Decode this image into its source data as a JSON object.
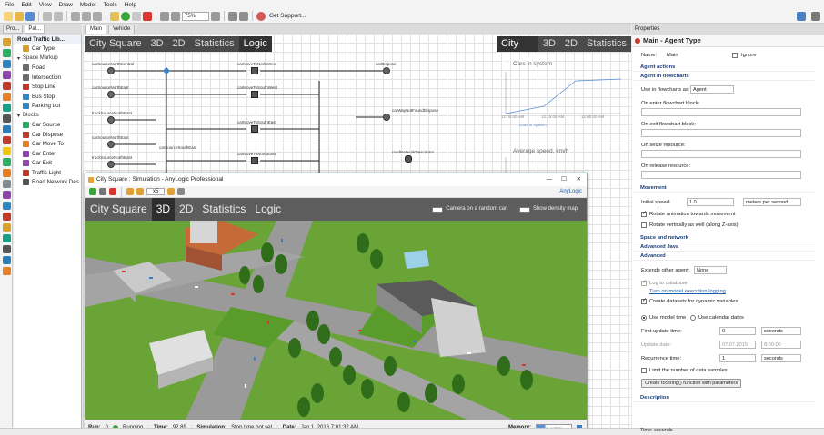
{
  "menu": [
    "File",
    "Edit",
    "View",
    "Draw",
    "Model",
    "Tools",
    "Help"
  ],
  "toolbar": {
    "zoom": "75%",
    "support_label": "Get Support..."
  },
  "palette": {
    "tabs": [
      "Pro...",
      "Pal..."
    ],
    "title": "Road Traffic Lib...",
    "items": [
      {
        "label": "Car Type",
        "kind": "item",
        "icon": "car-type-icon",
        "color": "#d9a12b"
      },
      {
        "label": "Space Markup",
        "kind": "section"
      },
      {
        "label": "Road",
        "kind": "item",
        "icon": "road-icon",
        "color": "#6b6b6b"
      },
      {
        "label": "Intersection",
        "kind": "item",
        "icon": "intersection-icon",
        "color": "#6b6b6b"
      },
      {
        "label": "Stop Line",
        "kind": "item",
        "icon": "stop-line-icon",
        "color": "#c0392b"
      },
      {
        "label": "Bus Stop",
        "kind": "item",
        "icon": "bus-stop-icon",
        "color": "#2e86c1"
      },
      {
        "label": "Parking Lot",
        "kind": "item",
        "icon": "parking-lot-icon",
        "color": "#2e86c1"
      },
      {
        "label": "Blocks",
        "kind": "section"
      },
      {
        "label": "Car Source",
        "kind": "item",
        "icon": "car-source-icon",
        "color": "#27ae60"
      },
      {
        "label": "Car Dispose",
        "kind": "item",
        "icon": "car-dispose-icon",
        "color": "#c0392b"
      },
      {
        "label": "Car Move To",
        "kind": "item",
        "icon": "car-move-to-icon",
        "color": "#e67e22"
      },
      {
        "label": "Car Enter",
        "kind": "item",
        "icon": "car-enter-icon",
        "color": "#8e44ad"
      },
      {
        "label": "Car Exit",
        "kind": "item",
        "icon": "car-exit-icon",
        "color": "#8e44ad"
      },
      {
        "label": "Traffic Light",
        "kind": "item",
        "icon": "traffic-light-icon",
        "color": "#c0392b"
      },
      {
        "label": "Road Network Des...",
        "kind": "item",
        "icon": "road-network-icon",
        "color": "#555"
      }
    ]
  },
  "editor": {
    "tabs": [
      "Main",
      "Vehicle"
    ],
    "nav": [
      "City Square",
      "3D",
      "2D",
      "Statistics",
      "Logic"
    ],
    "nav_selected": "Logic",
    "nav2": [
      "City Square",
      "3D",
      "2D",
      "Statistics"
    ],
    "flow_nodes": [
      "carSourceNorthCentral",
      "carSourceNorthEast",
      "truckSourceNorthEast",
      "carSourceNorthEast",
      "truckSourceNorthEast",
      "carSourceNorthWest",
      "carSourceSouthEast",
      "carMoveToNorthWest",
      "carMoveToSouthWest",
      "carMoveToSouthEast",
      "carMoveToNorthEast",
      "carMoveToNorthWest",
      "carDispose",
      "carWayNotFoundDispose",
      "roadNetworkDescriptor"
    ],
    "chart1": {
      "title": "Cars in system",
      "ticks": [
        "12:00:00 AM",
        "12:15:00 AM",
        "12:00:00 AM"
      ],
      "legend": "Cars in system"
    },
    "chart2": {
      "title": "Average speed, km/h"
    }
  },
  "sim": {
    "title": "City Square : Simulation - AnyLogic Professional",
    "speed": "x5",
    "brand": "AnyLogic",
    "nav": [
      "City Square",
      "3D",
      "2D",
      "Statistics",
      "Logic"
    ],
    "nav_selected": "3D",
    "camera_label": "Camera on a random car",
    "density_label": "Show density map",
    "status": {
      "run_label": "Run:",
      "run_value": "0",
      "state": "Running",
      "time_label": "Time:",
      "time_value": "92.89",
      "simtime_label": "Simulation:",
      "simtime_value": "Stop time not set",
      "date_label": "Date:",
      "date_value": "Jan 1, 2016 7:01:32 AM",
      "memory_label": "Memory:",
      "memory_value": "0 of 455M"
    }
  },
  "props": {
    "tab": "Properties",
    "header": "Main - Agent Type",
    "name_label": "Name:",
    "name_value": "Main",
    "ignore_label": "Ignore",
    "sec_agent_actions": "Agent actions",
    "sec_agent_in_flowcharts": "Agent in flowcharts",
    "use_in_flowcharts_label": "Use in flowcharts as:",
    "use_in_flowcharts_value": "Agent",
    "on_enter_label": "On enter flowchart block:",
    "on_exit_label": "On exit flowchart block:",
    "on_seize_label": "On seize resource:",
    "on_release_label": "On release resource:",
    "sec_movement": "Movement",
    "initial_speed_label": "Initial speed:",
    "initial_speed_value": "1.0",
    "speed_unit": "meters per second",
    "rotate_label": "Rotate animation towards movement",
    "rotate_z_label": "Rotate vertically as well (along Z-axis)",
    "sec_space": "Space and network",
    "sec_java": "Advanced Java",
    "sec_advanced": "Advanced",
    "extends_label": "Extends other agent:",
    "extends_value": "None",
    "log_label": "Log to database",
    "turn_on_label": "Turn on model execution logging",
    "datasets_label": "Create datasets for dynamic variables",
    "model_time_label": "Use model time",
    "calendar_label": "Use calendar dates",
    "first_update_label": "First update time:",
    "first_update_value": "0",
    "first_update_unit": "seconds",
    "update_date_label": "Update date:",
    "update_date_value": "07.07.2015",
    "update_time_value": "8:00:00",
    "recurrence_label": "Recurrence time:",
    "recurrence_value": "1",
    "recurrence_unit": "seconds",
    "limit_label": "Limit the number of data samples",
    "tostring_label": "Create toString() function with parameters",
    "sec_description": "Description"
  },
  "bottom": {
    "time_units": "Time: seconds"
  }
}
